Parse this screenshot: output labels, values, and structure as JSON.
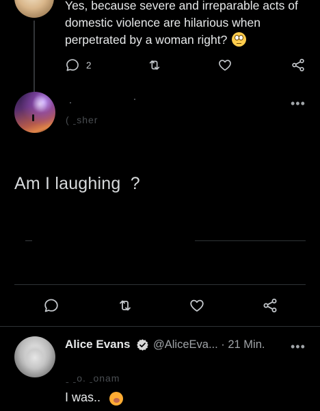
{
  "tweet_top": {
    "text": "Yes, because severe and irreparable acts of domestic violence are hilarious when perpetrated by a woman right?",
    "emoji": "face-with-rolling-eyes",
    "reply_count": "2"
  },
  "tweet_middle": {
    "handle_fragment": "(         ˍsher",
    "text": "Am I laughing  ?"
  },
  "tweet_alice": {
    "name": "Alice Evans",
    "handle_time": "@AliceEva... · 21 Min.",
    "reply_fragment": "ˍ  ˍo.         ˍonam",
    "text": "I was..",
    "emoji": "face-with-hand-over-mouth"
  },
  "colors": {
    "background": "#000000",
    "text": "#e7e9ea",
    "muted": "#a0a4a8",
    "divider": "#2f3336"
  }
}
